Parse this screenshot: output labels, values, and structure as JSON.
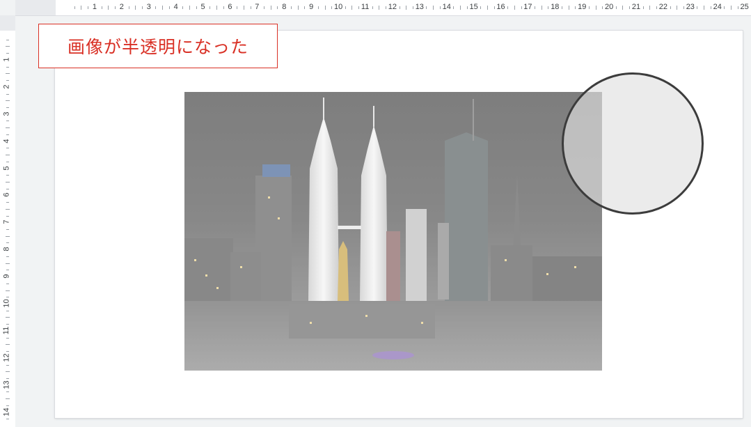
{
  "ruler": {
    "horizontal": [
      "1",
      "2",
      "3",
      "4",
      "5",
      "6",
      "7",
      "8",
      "9",
      "10",
      "11",
      "12",
      "13",
      "14",
      "15",
      "16",
      "17",
      "18",
      "19",
      "20",
      "21",
      "22",
      "23",
      "24",
      "25"
    ],
    "vertical": [
      "1",
      "2",
      "3",
      "4",
      "5",
      "6",
      "7",
      "8",
      "9",
      "10",
      "11",
      "12",
      "13",
      "14"
    ]
  },
  "slide": {
    "label": "画像が半透明になった",
    "label_color": "#d93025",
    "image": {
      "subject": "night city skyline with twin towers",
      "opacity_state": "semi-transparent"
    },
    "circle_annotation": "circle-highlight"
  }
}
